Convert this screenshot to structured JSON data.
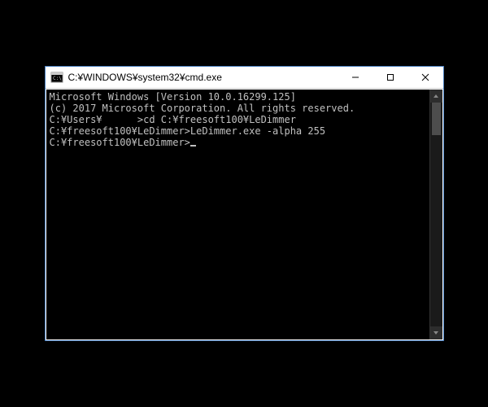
{
  "window": {
    "title": "C:¥WINDOWS¥system32¥cmd.exe"
  },
  "terminal": {
    "lines": [
      "Microsoft Windows [Version 10.0.16299.125]",
      "(c) 2017 Microsoft Corporation. All rights reserved.",
      "",
      "C:¥Users¥      >cd C:¥freesoft100¥LeDimmer",
      "",
      "C:¥freesoft100¥LeDimmer>LeDimmer.exe -alpha 255",
      "",
      "C:¥freesoft100¥LeDimmer>"
    ]
  }
}
